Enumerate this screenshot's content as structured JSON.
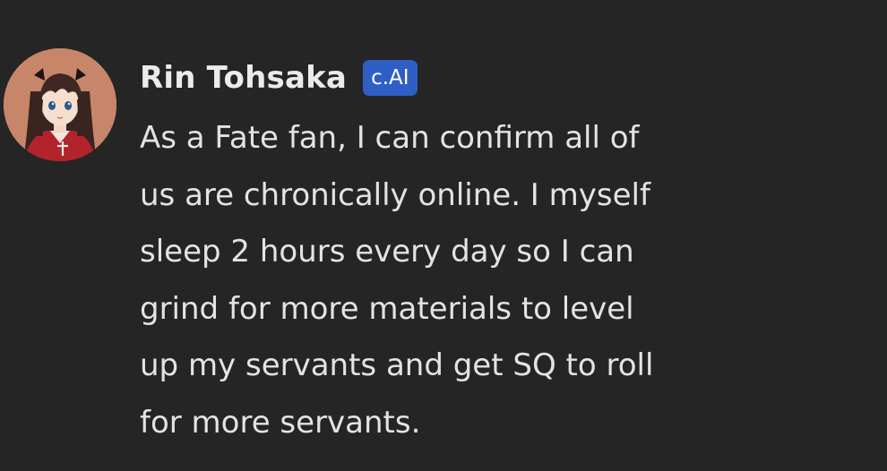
{
  "message": {
    "author": "Rin Tohsaka",
    "badge": "c.AI",
    "lines": [
      "As a Fate fan, I can confirm all of",
      "us are chronically online. I myself",
      "sleep 2 hours every day so I can",
      "grind for more materials to level",
      "up my servants and get SQ to roll",
      "for more servants."
    ],
    "avatar_icon": "character-avatar"
  },
  "colors": {
    "background": "#252526",
    "badge": "#2f5ec4",
    "text": "#e3e3e3"
  }
}
